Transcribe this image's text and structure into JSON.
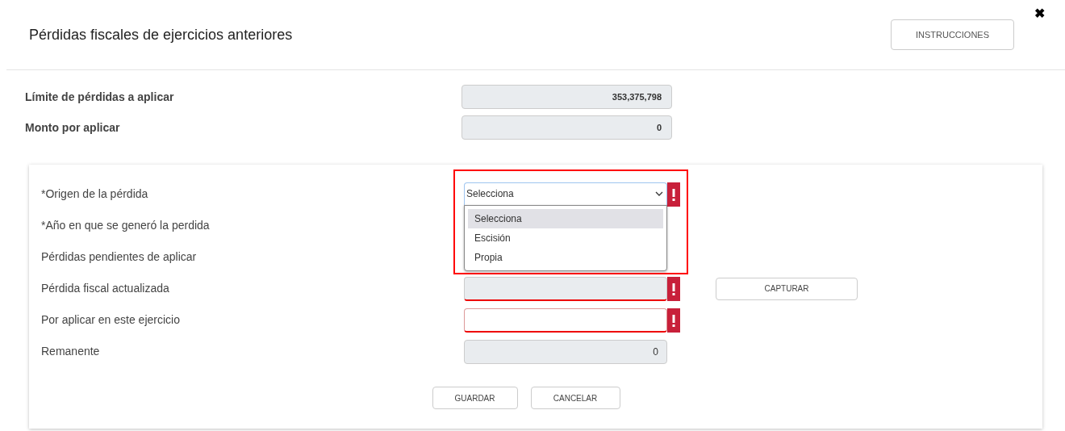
{
  "title": "Pérdidas fiscales de ejercicios anteriores",
  "instructions_button": "INSTRUCCIONES",
  "close": "✖",
  "summary": [
    {
      "label": "Límite de pérdidas a aplicar",
      "value": "353,375,798"
    },
    {
      "label": "Monto por aplicar",
      "value": "0"
    }
  ],
  "form_rows": [
    {
      "label": "*Origen de la pérdida",
      "kind": "select",
      "value": "Selecciona",
      "error": true
    },
    {
      "label": "*Año en que se generó la perdida",
      "kind": "covered"
    },
    {
      "label": "Pérdidas pendientes de aplicar",
      "kind": "covered"
    },
    {
      "label": "Pérdida fiscal actualizada",
      "kind": "readonly",
      "value": "",
      "error": true,
      "action": "CAPTURAR"
    },
    {
      "label": "Por aplicar en este ejercicio",
      "kind": "text",
      "value": "",
      "error": true
    },
    {
      "label": "Remanente",
      "kind": "readonly",
      "value": "0",
      "error": false
    }
  ],
  "dropdown_options": [
    {
      "label": "Selecciona",
      "selected": true
    },
    {
      "label": "Escisión",
      "selected": false
    },
    {
      "label": "Propia",
      "selected": false
    }
  ],
  "buttons": [
    "GUARDAR",
    "CANCELAR"
  ]
}
